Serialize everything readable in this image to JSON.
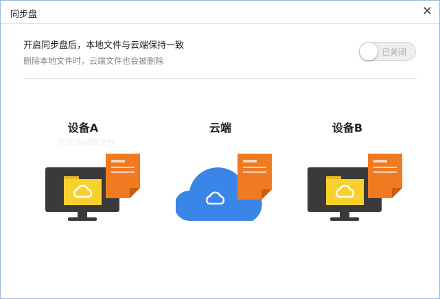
{
  "window": {
    "title": "同步盘",
    "close_icon": "close-icon"
  },
  "settings": {
    "headline": "开启同步盘后，本地文件与云端保持一致",
    "subtext": "删除本地文件时，云端文件也会被删除",
    "toggle_label": "已关闭",
    "toggle_on": false
  },
  "diagram": {
    "device_a": {
      "label": "设备A",
      "hint": "新增或编辑文件"
    },
    "cloud": {
      "label": "云端"
    },
    "device_b": {
      "label": "设备B"
    }
  },
  "colors": {
    "doc": "#f07a22",
    "folder": "#f9d12e",
    "cloud": "#3a86e8",
    "monitor": "#3a3a3a"
  }
}
